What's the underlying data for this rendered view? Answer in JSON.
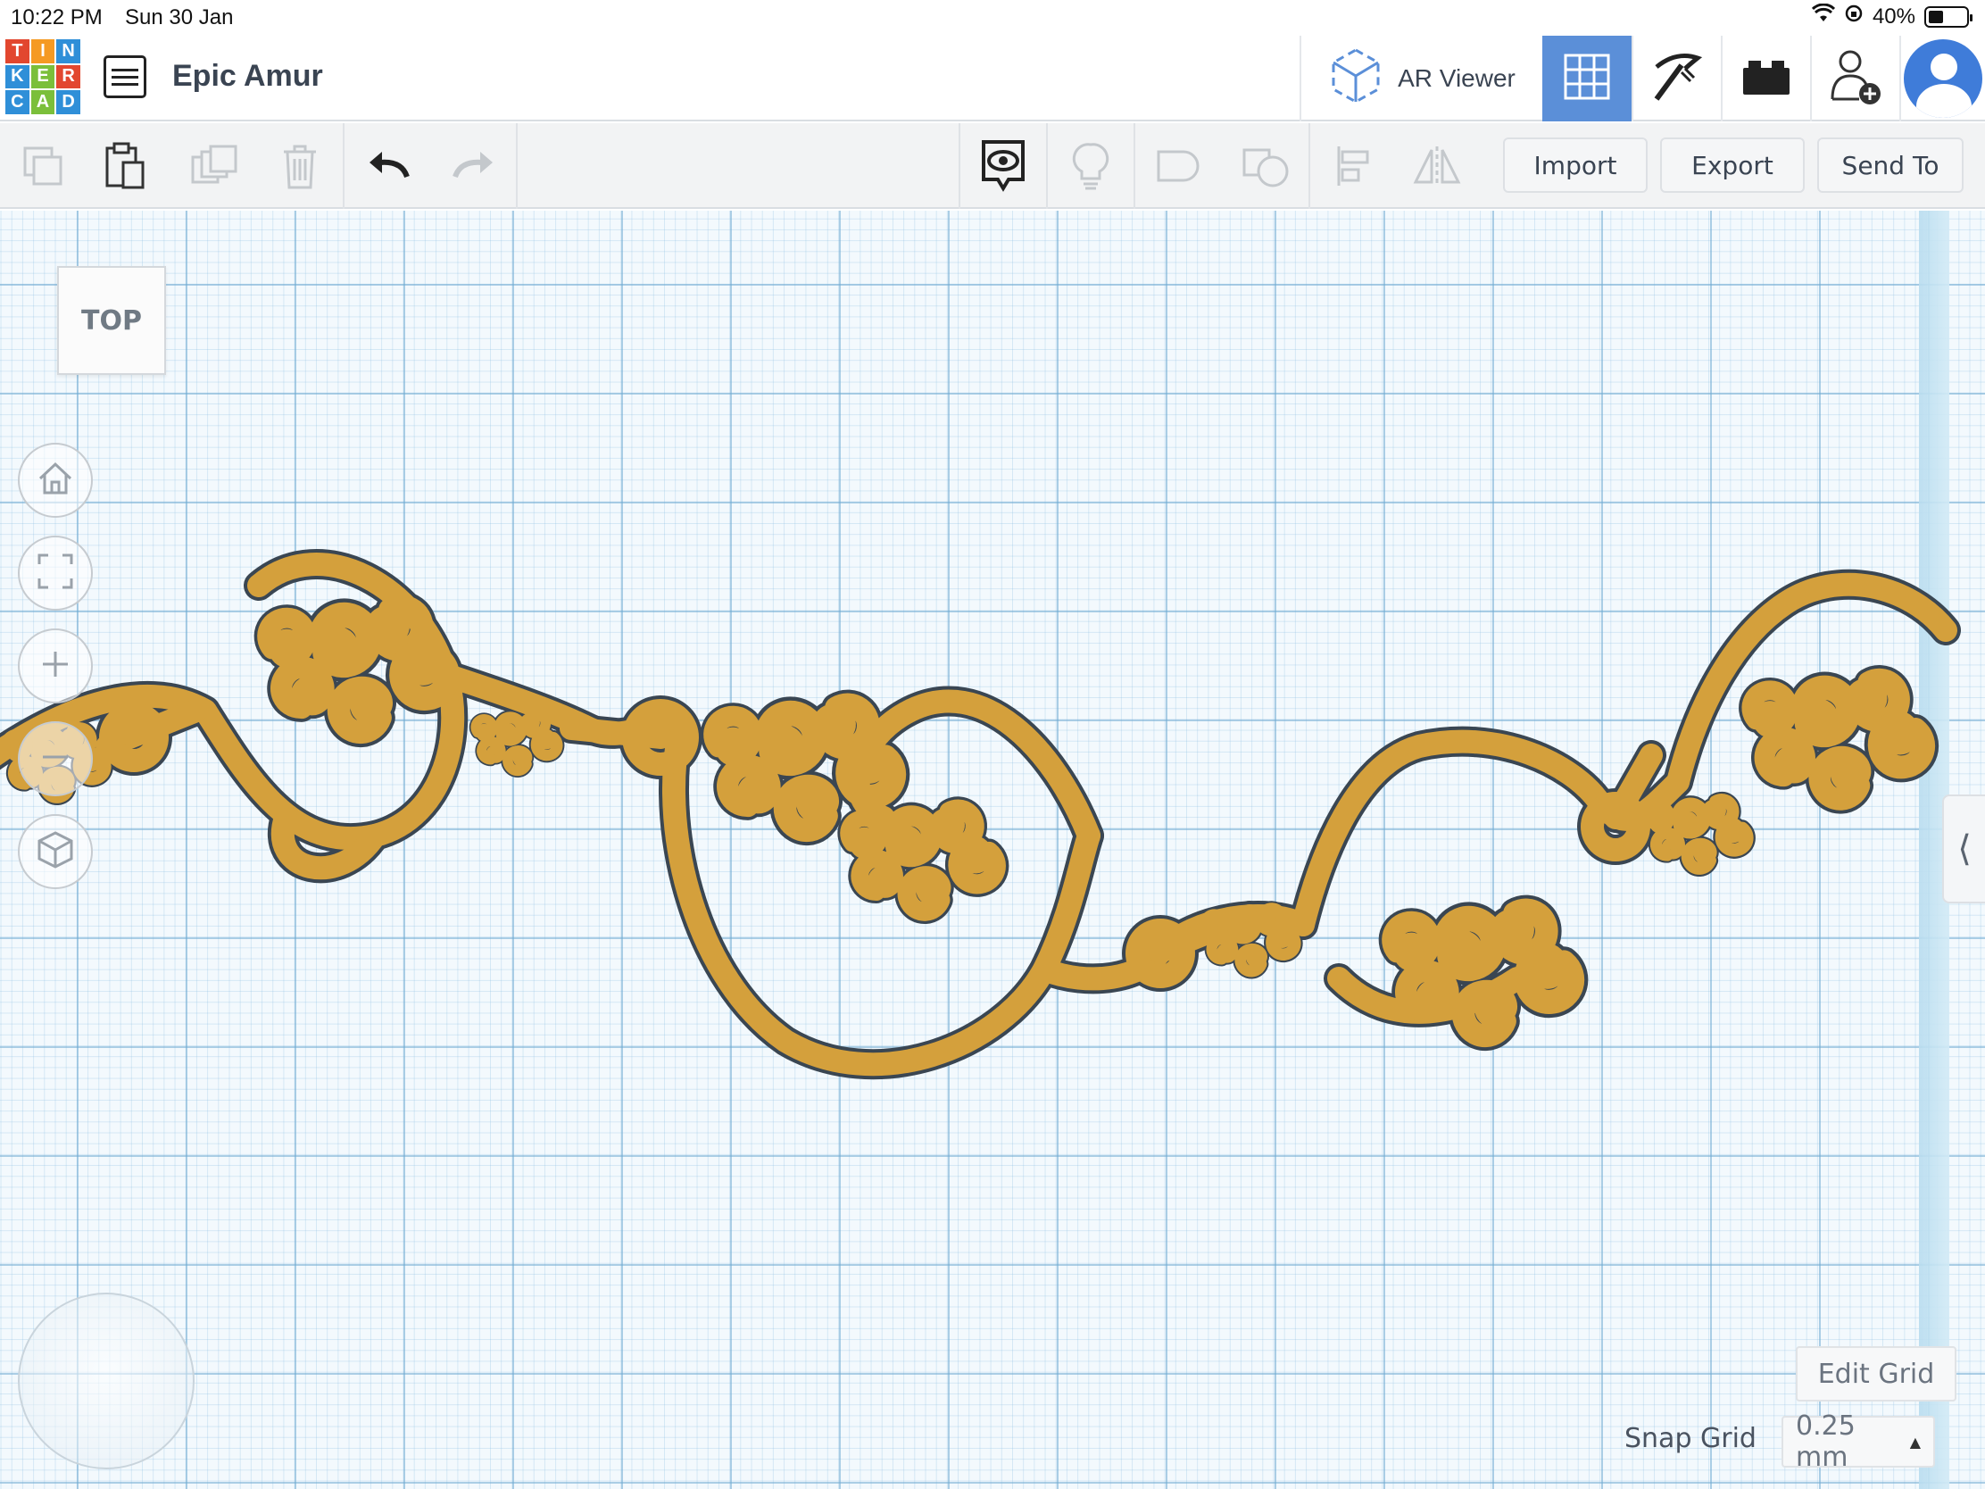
{
  "status_bar": {
    "time": "10:22 PM",
    "date": "Sun 30 Jan",
    "battery": "40%"
  },
  "logo": {
    "letters": [
      "T",
      "I",
      "N",
      "K",
      "E",
      "R",
      "C",
      "A",
      "D"
    ],
    "colors": [
      "#e2472f",
      "#f59a23",
      "#2f8fd8",
      "#2f8fd8",
      "#7bbf3a",
      "#e2472f",
      "#2f8fd8",
      "#7bbf3a",
      "#2f8fd8"
    ]
  },
  "header": {
    "title": "Epic Amur",
    "ar_viewer_label": "AR Viewer",
    "active_view": "3d-grid-view",
    "accent_color": "#5b8fd8"
  },
  "toolbar": {
    "import_label": "Import",
    "export_label": "Export",
    "send_to_label": "Send To",
    "left_icons": [
      "copy-icon",
      "paste-icon",
      "duplicate-icon",
      "trash-icon",
      "undo-icon",
      "redo-icon"
    ],
    "right_icons": [
      "notes-eye-icon",
      "light-bulb-icon",
      "group-icon",
      "ungroup-icon",
      "align-icon",
      "mirror-icon"
    ]
  },
  "workplane": {
    "view_cube_label": "TOP",
    "nav_buttons": [
      "home-icon",
      "fit-view-icon",
      "zoom-in-icon",
      "zoom-out-icon",
      "perspective-cube-icon"
    ],
    "edit_grid_label": "Edit Grid",
    "snap_grid_label": "Snap Grid",
    "snap_grid_value": "0.25 mm",
    "grid_color": "#8cc0e0",
    "model_color": "#d4a03c",
    "model_outline_color": "#3a4652"
  }
}
